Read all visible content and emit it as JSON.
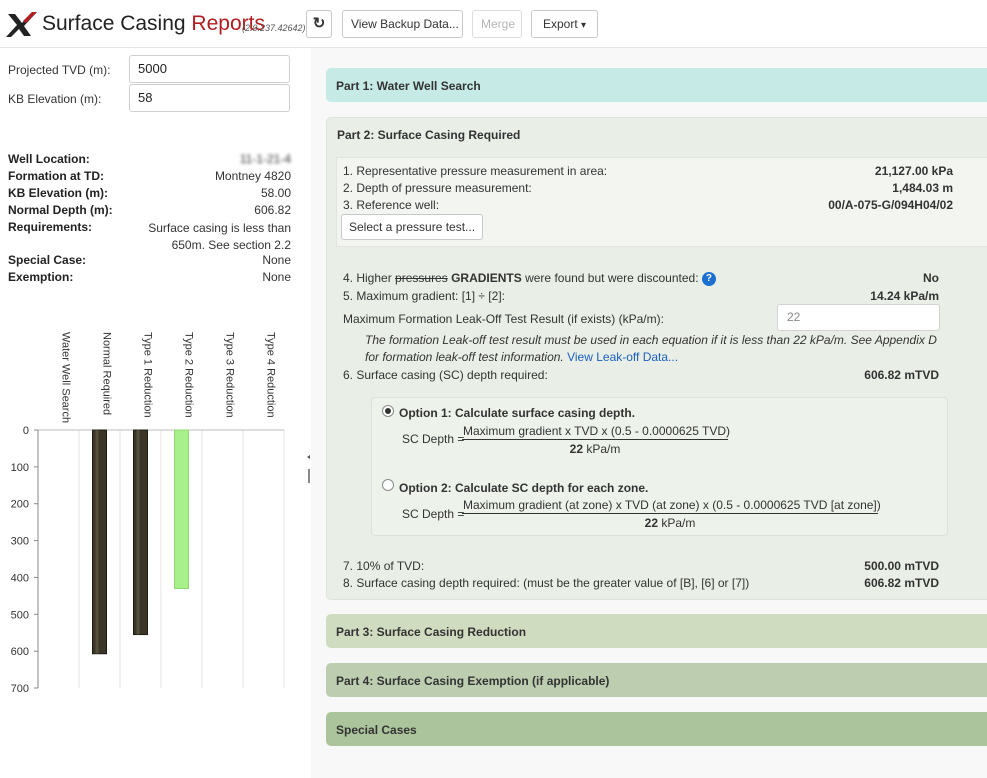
{
  "header": {
    "title_main": "Surface Casing",
    "title_accent": "Reports",
    "version": "(2.9.237.42642)",
    "refresh_glyph": "↻",
    "backup_label": "View Backup Data...",
    "merge_label": "Merge",
    "export_label": "Export",
    "export_caret": "▾",
    "brand_color": "#b01e23"
  },
  "inputs": {
    "projected_tvd_label": "Projected TVD (m):",
    "projected_tvd_value": "5000",
    "kb_elevation_label": "KB Elevation (m):",
    "kb_elevation_value": "58"
  },
  "well_info": {
    "well_location_label": "Well Location:",
    "well_location_value": "11-1-21-4",
    "formation_label": "Formation at TD:",
    "formation_value": "Montney 4820",
    "kb_label": "KB Elevation (m):",
    "kb_value": "58.00",
    "normal_depth_label": "Normal Depth (m):",
    "normal_depth_value": "606.82",
    "requirements_label": "Requirements:",
    "requirements_line1": "Surface casing is less than",
    "requirements_line2": "650m. See section 2.2",
    "special_case_label": "Special Case:",
    "special_case_value": "None",
    "exemption_label": "Exemption:",
    "exemption_value": "None"
  },
  "chart_data": {
    "type": "bar",
    "categories": [
      "Water Well Search",
      "Normal Required",
      "Type 1 Reduction",
      "Type 2 Reduction",
      "Type 3 Reduction",
      "Type 4 Reduction"
    ],
    "values": [
      null,
      607,
      555,
      430,
      null,
      null
    ],
    "colors": [
      "#3a3526",
      "#3a3526",
      "#3a3526",
      "#a8f08a",
      "#3a3526",
      "#3a3526"
    ],
    "ylim": [
      0,
      700
    ],
    "y_inverted": true,
    "yticks": [
      0,
      100,
      200,
      300,
      400,
      500,
      600,
      700
    ],
    "grid": true
  },
  "part1": {
    "title": "Part 1: Water Well Search"
  },
  "part2": {
    "title": "Part 2: Surface Casing Required",
    "line1_label": "1. Representative pressure measurement in area:",
    "line1_value": "21,127.00 kPa",
    "line2_label": "2. Depth of pressure measurement:",
    "line2_value": "1,484.03 m",
    "line3_label": "3. Reference well:",
    "line3_value": "00/A-075-G/094H04/02",
    "select_test_label": "Select a pressure test...",
    "line4_prefix": "4. Higher",
    "line4_struck": "pressures",
    "line4_bold": "GRADIENTS",
    "line4_suffix": "were found but were discounted:",
    "line4_help": "?",
    "line4_value": "No",
    "line5_label": "5. Maximum gradient: [1] ÷ [2]:",
    "line5_value": "14.24 kPa/m",
    "leakoff_label": "Maximum Formation Leak-Off Test Result (if exists) (kPa/m):",
    "leakoff_placeholder": "22",
    "note_text": "The formation Leak-off test result must be used in each equation if it is less than 22 kPa/m. See Appendix D for formation leak-off test information.",
    "note_link": "View Leak-off Data...",
    "line6_label": "6. Surface casing (SC) depth required:",
    "line6_value": "606.82 mTVD",
    "option1_label": "Option 1: Calculate surface casing depth.",
    "option1_lhs": "SC Depth =",
    "option1_num": "Maximum gradient x TVD x (0.5 - 0.0000625 TVD)",
    "option1_den_num": "22",
    "option1_den_unit": "kPa/m",
    "option2_label": "Option 2: Calculate SC depth for each zone.",
    "option2_lhs": "SC Depth =",
    "option2_num": "Maximum gradient (at zone) x TVD (at zone) x (0.5 - 0.0000625 TVD [at zone])",
    "option2_den_num": "22",
    "option2_den_unit": "kPa/m",
    "line7_label": "7. 10% of TVD:",
    "line7_value": "500.00 mTVD",
    "line8_label": "8. Surface casing depth required: (must be the greater value of [B], [6] or [7])",
    "line8_value": "606.82 mTVD"
  },
  "part3": {
    "title": "Part 3: Surface Casing Reduction"
  },
  "part4": {
    "title": "Part 4: Surface Casing Exemption (if applicable)"
  },
  "part5": {
    "title": "Special Cases"
  }
}
